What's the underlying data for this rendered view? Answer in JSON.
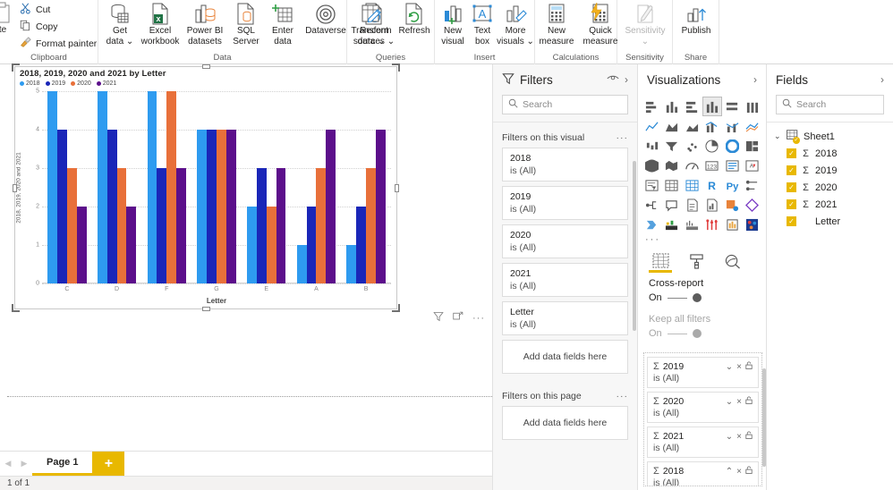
{
  "ribbon": {
    "clipboard": {
      "group_label": "Clipboard",
      "paste_label": "te",
      "items": [
        {
          "label": "Cut",
          "icon": "scissors-icon"
        },
        {
          "label": "Copy",
          "icon": "copy-icon"
        },
        {
          "label": "Format painter",
          "icon": "format-painter-icon"
        }
      ]
    },
    "data": {
      "group_label": "Data",
      "items": [
        {
          "line1": "Get",
          "line2": "data",
          "caret": true,
          "icon": "get-data-icon"
        },
        {
          "line1": "Excel",
          "line2": "workbook",
          "caret": false,
          "icon": "excel-workbook-icon"
        },
        {
          "line1": "Power BI",
          "line2": "datasets",
          "caret": false,
          "icon": "powerbi-datasets-icon"
        },
        {
          "line1": "SQL",
          "line2": "Server",
          "caret": false,
          "icon": "sql-server-icon"
        },
        {
          "line1": "Enter",
          "line2": "data",
          "caret": false,
          "icon": "enter-data-icon"
        },
        {
          "line1": "Dataverse",
          "line2": "",
          "caret": false,
          "icon": "dataverse-icon"
        },
        {
          "line1": "Recent",
          "line2": "sources",
          "caret": true,
          "icon": "recent-sources-icon"
        }
      ]
    },
    "queries": {
      "group_label": "Queries",
      "items": [
        {
          "line1": "Transform",
          "line2": "data",
          "caret": true,
          "icon": "transform-data-icon"
        },
        {
          "line1": "Refresh",
          "line2": "",
          "caret": false,
          "icon": "refresh-icon"
        }
      ]
    },
    "insert": {
      "group_label": "Insert",
      "items": [
        {
          "line1": "New",
          "line2": "visual",
          "caret": false,
          "icon": "new-visual-icon"
        },
        {
          "line1": "Text",
          "line2": "box",
          "caret": false,
          "icon": "text-box-icon"
        },
        {
          "line1": "More",
          "line2": "visuals",
          "caret": true,
          "icon": "more-visuals-icon"
        }
      ]
    },
    "calculations": {
      "group_label": "Calculations",
      "items": [
        {
          "line1": "New",
          "line2": "measure",
          "caret": false,
          "icon": "new-measure-icon"
        },
        {
          "line1": "Quick",
          "line2": "measure",
          "caret": false,
          "icon": "quick-measure-icon"
        }
      ]
    },
    "sensitivity": {
      "group_label": "Sensitivity",
      "items": [
        {
          "line1": "Sensitivity",
          "line2": "",
          "caret": true,
          "icon": "sensitivity-icon",
          "disabled": true
        }
      ]
    },
    "share": {
      "group_label": "Share",
      "items": [
        {
          "line1": "Publish",
          "line2": "",
          "caret": false,
          "icon": "publish-icon"
        }
      ]
    }
  },
  "chart_data": {
    "type": "bar",
    "title": "2018, 2019, 2020 and 2021 by Letter",
    "xlabel": "Letter",
    "ylabel": "2018, 2019, 2020 and 2021",
    "categories": [
      "C",
      "D",
      "F",
      "G",
      "E",
      "A",
      "B"
    ],
    "series": [
      {
        "name": "2018",
        "color": "#2E9BF0",
        "values": [
          5,
          5,
          5,
          4,
          2,
          1,
          1
        ]
      },
      {
        "name": "2019",
        "color": "#1A26B8",
        "values": [
          4,
          4,
          3,
          4,
          3,
          2,
          2
        ]
      },
      {
        "name": "2020",
        "color": "#E8703A",
        "values": [
          3,
          3,
          5,
          4,
          2,
          3,
          3
        ]
      },
      {
        "name": "2021",
        "color": "#5C0F8B",
        "values": [
          2,
          2,
          3,
          4,
          3,
          4,
          4
        ]
      }
    ],
    "ylim": [
      0,
      5
    ],
    "yticks": [
      0,
      1,
      2,
      3,
      4,
      5
    ],
    "grid": true,
    "legend_position": "top-left"
  },
  "visual_footer": {
    "filter_icon": "funnel-icon",
    "focus_icon": "focus-mode-icon",
    "more_label": "···"
  },
  "filters": {
    "title": "Filters",
    "eye_icon": "eye-icon",
    "collapse_icon": "chevron-right-icon",
    "search_placeholder": "Search",
    "visual_section": {
      "label": "Filters on this visual",
      "more_label": "···",
      "cards": [
        {
          "name": "2018",
          "value": "is (All)"
        },
        {
          "name": "2019",
          "value": "is (All)"
        },
        {
          "name": "2020",
          "value": "is (All)"
        },
        {
          "name": "2021",
          "value": "is (All)"
        },
        {
          "name": "Letter",
          "value": "is (All)"
        }
      ],
      "drop_label": "Add data fields here"
    },
    "page_section": {
      "label": "Filters on this page",
      "more_label": "···",
      "drop_label": "Add data fields here"
    }
  },
  "visualizations": {
    "title": "Visualizations",
    "collapse_icon": "chevron-right-icon",
    "more_label": "···",
    "selected_index": 3,
    "icons": [
      "stacked-bar-chart-icon",
      "stacked-column-chart-icon",
      "clustered-bar-chart-icon",
      "clustered-column-chart-icon",
      "100-stacked-bar-chart-icon",
      "100-stacked-column-chart-icon",
      "line-chart-icon",
      "area-chart-icon",
      "stacked-area-chart-icon",
      "line-stacked-column-icon",
      "line-clustered-column-icon",
      "ribbon-chart-icon",
      "waterfall-chart-icon",
      "funnel-icon",
      "scatter-chart-icon",
      "pie-chart-icon",
      "donut-chart-icon",
      "treemap-icon",
      "map-icon",
      "filled-map-icon",
      "gauge-icon",
      "card-icon",
      "multi-row-card-icon",
      "kpi-icon",
      "slicer-icon",
      "table-icon",
      "matrix-icon",
      "r-visual-icon",
      "python-visual-icon",
      "key-influencers-icon",
      "decomposition-tree-icon",
      "qna-icon",
      "smart-narrative-icon",
      "paginated-report-icon",
      "powerapps-icon",
      "power-automate-icon",
      "arcgis-maps-icon",
      "chiclet-slicer-icon",
      "timeline-slicer-icon",
      "tornado-chart-icon",
      "bullet-chart-icon",
      "scatter-matrix-icon"
    ],
    "well_tabs": [
      {
        "icon": "fields-tab-icon",
        "selected": true
      },
      {
        "icon": "format-tab-icon",
        "selected": false
      },
      {
        "icon": "analytics-tab-icon",
        "selected": false
      }
    ],
    "cross_report": {
      "label": "Cross-report",
      "state": "On",
      "enabled": true
    },
    "keep_all_filters": {
      "label": "Keep all filters",
      "state": "On",
      "enabled": false
    },
    "wells": [
      {
        "sigma": "Σ",
        "name": "2019",
        "value": "is (All)",
        "chevron": "chevron-down-icon",
        "chevron_glyph": "⌄",
        "remove": "×",
        "lock": "🔓"
      },
      {
        "sigma": "Σ",
        "name": "2020",
        "value": "is (All)",
        "chevron": "chevron-down-icon",
        "chevron_glyph": "⌄",
        "remove": "×",
        "lock": "🔓"
      },
      {
        "sigma": "Σ",
        "name": "2021",
        "value": "is (All)",
        "chevron": "chevron-down-icon",
        "chevron_glyph": "⌄",
        "remove": "×",
        "lock": "🔓"
      },
      {
        "sigma": "Σ",
        "name": "2018",
        "value": "is (All)",
        "chevron": "chevron-up-icon",
        "chevron_glyph": "⌃",
        "remove": "×",
        "lock": "🔓"
      }
    ]
  },
  "fields": {
    "title": "Fields",
    "collapse_icon": "chevron-right-icon",
    "search_placeholder": "Search",
    "table": {
      "name": "Sheet1",
      "expanded": true
    },
    "items": [
      {
        "label": "2018",
        "checked": true,
        "measure": true
      },
      {
        "label": "2019",
        "checked": true,
        "measure": true
      },
      {
        "label": "2020",
        "checked": true,
        "measure": true
      },
      {
        "label": "2021",
        "checked": true,
        "measure": true
      },
      {
        "label": "Letter",
        "checked": true,
        "measure": false
      }
    ]
  },
  "pagebar": {
    "prev_icon": "chevron-left-icon",
    "next_icon": "chevron-right-icon",
    "tabs": [
      {
        "label": "Page 1",
        "active": true
      }
    ],
    "add_label": "+",
    "status": "1 of 1"
  }
}
